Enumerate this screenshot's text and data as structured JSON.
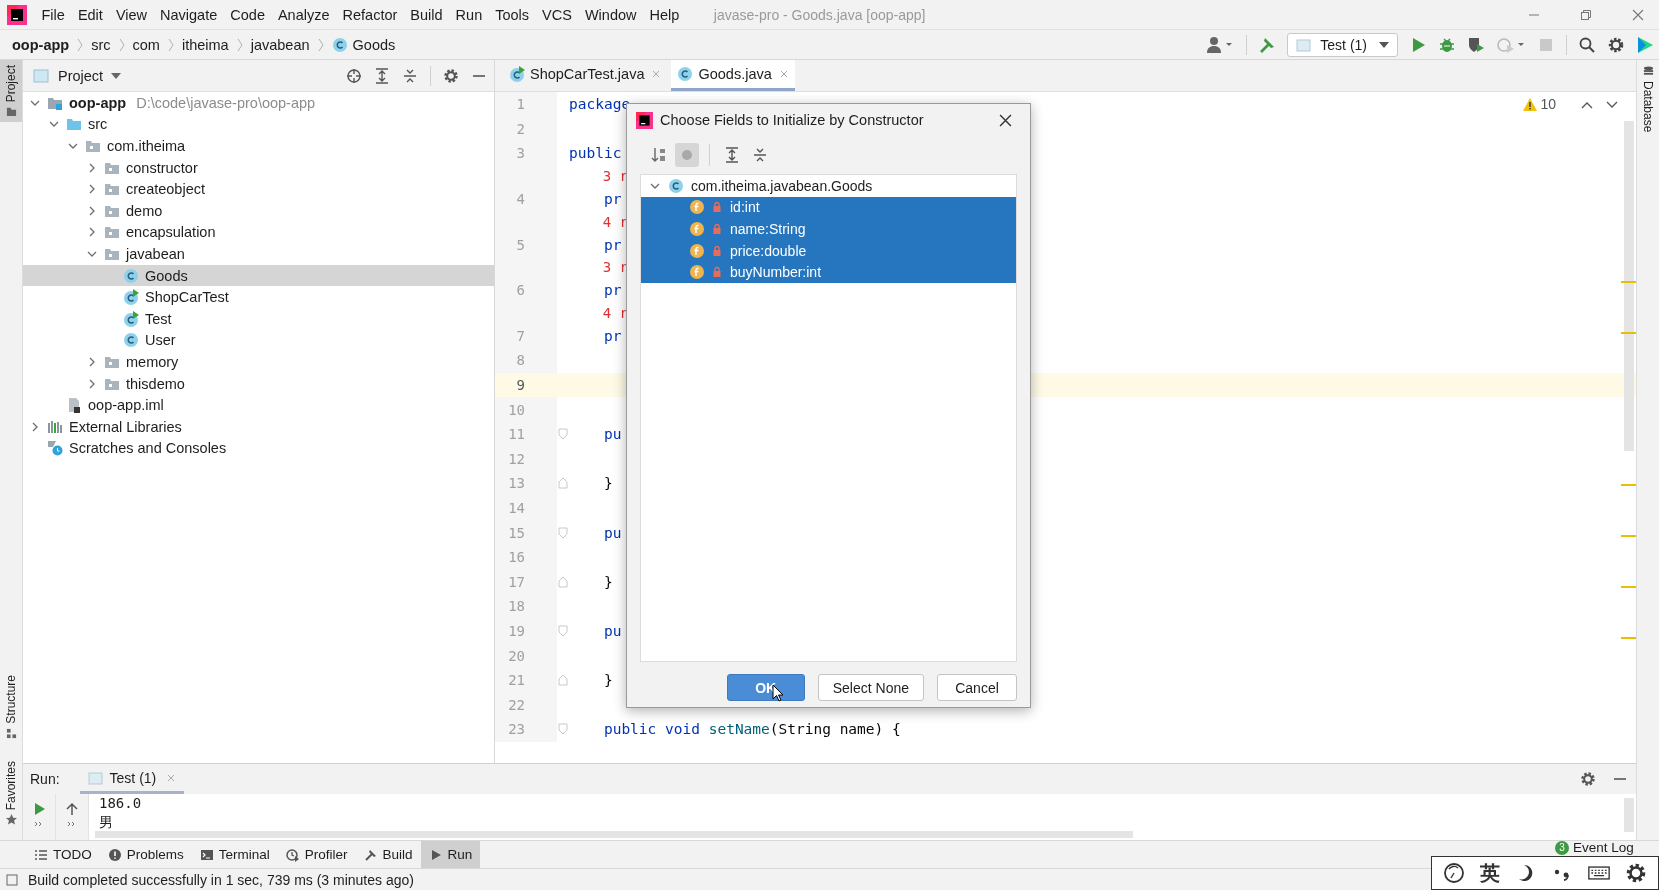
{
  "window": {
    "title": "javase-pro - Goods.java [oop-app]"
  },
  "menu": [
    "File",
    "Edit",
    "View",
    "Navigate",
    "Code",
    "Analyze",
    "Refactor",
    "Build",
    "Run",
    "Tools",
    "VCS",
    "Window",
    "Help"
  ],
  "breadcrumbs": [
    {
      "label": "oop-app",
      "kind": "module"
    },
    {
      "label": "src",
      "kind": "folder"
    },
    {
      "label": "com",
      "kind": "folder"
    },
    {
      "label": "itheima",
      "kind": "folder"
    },
    {
      "label": "javabean",
      "kind": "folder"
    },
    {
      "label": "Goods",
      "kind": "class"
    }
  ],
  "toolbar": {
    "run_config": "Test (1)"
  },
  "left_stripe": [
    {
      "label": "Project",
      "selected": true,
      "kind": "project"
    },
    {
      "label": "Structure",
      "selected": false,
      "kind": "structure"
    },
    {
      "label": "Favorites",
      "selected": false,
      "kind": "favorites"
    }
  ],
  "right_stripe": [
    {
      "label": "Database"
    }
  ],
  "project_panel": {
    "title": "Project",
    "tree": [
      {
        "label": "oop-app",
        "kind": "module",
        "hint": "D:\\code\\javase-pro\\oop-app",
        "expanded": true,
        "selected": false,
        "children": [
          {
            "label": "src",
            "kind": "source-folder",
            "expanded": true,
            "selected": false,
            "children": [
              {
                "label": "com.itheima",
                "kind": "package",
                "expanded": true,
                "selected": false,
                "children": [
                  {
                    "label": "constructor",
                    "kind": "package",
                    "expanded": false,
                    "selected": false
                  },
                  {
                    "label": "createobject",
                    "kind": "package",
                    "expanded": false,
                    "selected": false
                  },
                  {
                    "label": "demo",
                    "kind": "package",
                    "expanded": false,
                    "selected": false
                  },
                  {
                    "label": "encapsulation",
                    "kind": "package",
                    "expanded": false,
                    "selected": false
                  },
                  {
                    "label": "javabean",
                    "kind": "package",
                    "expanded": true,
                    "selected": false,
                    "children": [
                      {
                        "label": "Goods",
                        "kind": "class",
                        "selected": true
                      },
                      {
                        "label": "ShopCarTest",
                        "kind": "runnable-class",
                        "selected": false
                      },
                      {
                        "label": "Test",
                        "kind": "runnable-class",
                        "selected": false
                      },
                      {
                        "label": "User",
                        "kind": "class",
                        "selected": false
                      }
                    ]
                  },
                  {
                    "label": "memory",
                    "kind": "package",
                    "expanded": false,
                    "selected": false
                  },
                  {
                    "label": "thisdemo",
                    "kind": "package",
                    "expanded": false,
                    "selected": false
                  }
                ]
              }
            ]
          },
          {
            "label": "oop-app.iml",
            "kind": "iml",
            "selected": false
          }
        ]
      },
      {
        "label": "External Libraries",
        "kind": "libraries",
        "expanded": false,
        "selected": false
      },
      {
        "label": "Scratches and Consoles",
        "kind": "scratches",
        "selected": false
      }
    ]
  },
  "editor": {
    "tabs": [
      {
        "label": "ShopCarTest.java",
        "kind": "runnable-class",
        "selected": false
      },
      {
        "label": "Goods.java",
        "kind": "class",
        "selected": true
      }
    ],
    "warnings": "10",
    "lines": [
      {
        "kind": "code",
        "number": "1",
        "current": false,
        "tokens": [
          {
            "text": "package",
            "kind": "keyword"
          }
        ]
      },
      {
        "kind": "code",
        "number": "2",
        "current": false
      },
      {
        "kind": "code",
        "number": "3",
        "current": false,
        "tokens": [
          {
            "text": "public",
            "kind": "keyword"
          }
        ]
      },
      {
        "kind": "inlay",
        "current": false,
        "tokens": [
          {
            "text": "    3 r",
            "kind": "inlay"
          }
        ]
      },
      {
        "kind": "code",
        "number": "4",
        "current": false,
        "tokens": [
          {
            "text": "    pr",
            "kind": "keyword"
          }
        ]
      },
      {
        "kind": "inlay",
        "current": false,
        "tokens": [
          {
            "text": "    4 r",
            "kind": "inlay"
          }
        ]
      },
      {
        "kind": "code",
        "number": "5",
        "current": false,
        "tokens": [
          {
            "text": "    pr",
            "kind": "keyword"
          }
        ]
      },
      {
        "kind": "inlay",
        "current": false,
        "tokens": [
          {
            "text": "    3 r",
            "kind": "inlay"
          }
        ]
      },
      {
        "kind": "code",
        "number": "6",
        "current": false,
        "tokens": [
          {
            "text": "    pr",
            "kind": "keyword"
          }
        ]
      },
      {
        "kind": "inlay",
        "current": false,
        "tokens": [
          {
            "text": "    4 r",
            "kind": "inlay"
          }
        ]
      },
      {
        "kind": "code",
        "number": "7",
        "current": false,
        "tokens": [
          {
            "text": "    pr",
            "kind": "keyword"
          }
        ]
      },
      {
        "kind": "code",
        "number": "8",
        "current": false
      },
      {
        "kind": "code",
        "number": "9",
        "current": true
      },
      {
        "kind": "code",
        "number": "10",
        "current": false
      },
      {
        "kind": "opener",
        "number": "11",
        "current": false,
        "tokens": [
          {
            "text": "    pu",
            "kind": "keyword"
          }
        ]
      },
      {
        "kind": "code",
        "number": "12",
        "current": false
      },
      {
        "kind": "closer",
        "number": "13",
        "current": false,
        "tokens": [
          {
            "text": "    }",
            "kind": "plain"
          }
        ]
      },
      {
        "kind": "code",
        "number": "14",
        "current": false
      },
      {
        "kind": "opener",
        "number": "15",
        "current": false,
        "tokens": [
          {
            "text": "    pu",
            "kind": "keyword"
          }
        ]
      },
      {
        "kind": "code",
        "number": "16",
        "current": false
      },
      {
        "kind": "closer",
        "number": "17",
        "current": false,
        "tokens": [
          {
            "text": "    }",
            "kind": "plain"
          }
        ]
      },
      {
        "kind": "code",
        "number": "18",
        "current": false
      },
      {
        "kind": "opener",
        "number": "19",
        "current": false,
        "tokens": [
          {
            "text": "    pu",
            "kind": "keyword"
          }
        ]
      },
      {
        "kind": "code",
        "number": "20",
        "current": false
      },
      {
        "kind": "closer",
        "number": "21",
        "current": false,
        "tokens": [
          {
            "text": "    }",
            "kind": "plain"
          }
        ]
      },
      {
        "kind": "code",
        "number": "22",
        "current": false
      },
      {
        "kind": "opener",
        "number": "23",
        "current": false,
        "tokens": [
          {
            "text": "    public ",
            "kind": "keyword"
          },
          {
            "text": "void ",
            "kind": "keyword"
          },
          {
            "text": "setName",
            "kind": "method"
          },
          {
            "text": "(String name) {",
            "kind": "plain"
          }
        ]
      }
    ]
  },
  "dialog": {
    "title": "Choose Fields to Initialize by Constructor",
    "toolbar": [
      {
        "kind": "sort",
        "selected": false
      },
      {
        "kind": "toggle",
        "selected": true
      },
      {
        "kind": "expand",
        "selected": false
      },
      {
        "kind": "collapse",
        "selected": false
      }
    ],
    "tree": [
      {
        "label": "com.itheima.javabean.Goods",
        "kind": "class",
        "expanded": true,
        "selected": false,
        "children": [
          {
            "label": "id:int",
            "kind": "field",
            "selected": true
          },
          {
            "label": "name:String",
            "kind": "field",
            "selected": true
          },
          {
            "label": "price:double",
            "kind": "field",
            "selected": true
          },
          {
            "label": "buyNumber:int",
            "kind": "field",
            "selected": true
          }
        ]
      }
    ],
    "buttons": [
      {
        "label": "OK",
        "default": true
      },
      {
        "label": "Select None",
        "default": false
      },
      {
        "label": "Cancel",
        "default": false
      }
    ]
  },
  "run_panel": {
    "label": "Run:",
    "tabs": [
      {
        "label": "Test (1)",
        "selected": true
      }
    ],
    "output": [
      "186.0",
      "男"
    ]
  },
  "tool_tabs": [
    {
      "label": "TODO",
      "kind": "todo",
      "selected": false
    },
    {
      "label": "Problems",
      "kind": "problems",
      "selected": false
    },
    {
      "label": "Terminal",
      "kind": "terminal",
      "selected": false
    },
    {
      "label": "Profiler",
      "kind": "profiler",
      "selected": false
    },
    {
      "label": "Build",
      "kind": "build",
      "selected": false
    },
    {
      "label": "Run",
      "kind": "run",
      "selected": true
    }
  ],
  "event_log": {
    "label": "Event Log",
    "count": "3"
  },
  "ime_bar": {
    "mode": "英"
  },
  "status_bar": {
    "message": "Build completed successfully in 1 sec, 739 ms (3 minutes ago)"
  }
}
